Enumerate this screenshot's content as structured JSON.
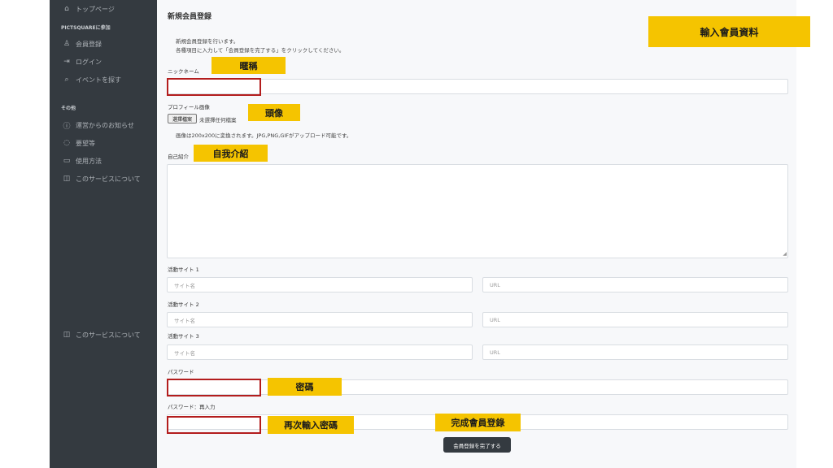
{
  "sidebar": {
    "items_top": [
      {
        "icon": "home-icon",
        "glyph": "⌂",
        "label": "トップページ"
      }
    ],
    "section_join": "PICTSQUAREに参加",
    "items_join": [
      {
        "icon": "user-plus-icon",
        "glyph": "♙",
        "label": "会員登録"
      },
      {
        "icon": "login-icon",
        "glyph": "⇥",
        "label": "ログイン"
      },
      {
        "icon": "search-icon",
        "glyph": "⌕",
        "label": "イベントを探す"
      }
    ],
    "section_other": "その他",
    "items_other": [
      {
        "icon": "info-icon",
        "glyph": "ⓘ",
        "label": "運営からのお知らせ"
      },
      {
        "icon": "chat-icon",
        "glyph": "◌",
        "label": "要望等"
      },
      {
        "icon": "comment-icon",
        "glyph": "▭",
        "label": "使用方法"
      },
      {
        "icon": "book-icon",
        "glyph": "◫",
        "label": "このサービスについて"
      }
    ],
    "bottom_item": {
      "icon": "book-icon",
      "glyph": "◫",
      "label": "このサービスについて"
    }
  },
  "form": {
    "title": "新規会員登録",
    "desc_line1": "新規会員登録を行います。",
    "desc_line2": "各種項目に入力して「会員登録を完了する」をクリックしてください。",
    "nickname_label": "ニックネーム",
    "nickname_value": "",
    "profile_image_label": "プロフィール画像",
    "file_button": "選擇檔案",
    "file_status": "未選擇任何檔案",
    "image_note": "画像は200x200に変換されます。JPG,PNG,GIFがアップロード可能です。",
    "bio_label": "自己紹介",
    "bio_value": "",
    "site1_label": "活動サイト 1",
    "site2_label": "活動サイト 2",
    "site3_label": "活動サイト 3",
    "site_name_placeholder": "サイト名",
    "site_url_placeholder": "URL",
    "password_label": "パスワード",
    "password_confirm_label": "パスワード：再入力",
    "submit_label": "会員登録を完了する"
  },
  "annotations": {
    "input_member_info": "輸入會員資料",
    "nickname": "暱稱",
    "avatar": "頭像",
    "self_intro": "自我介紹",
    "password": "密碼",
    "password_again": "再次輸入密碼",
    "complete_register": "完成會員登錄"
  },
  "colors": {
    "sidebar_bg": "#343a40",
    "annotation_yellow": "#f5c400",
    "highlight_red": "#b31d1d",
    "submit_bg": "#343a40"
  }
}
